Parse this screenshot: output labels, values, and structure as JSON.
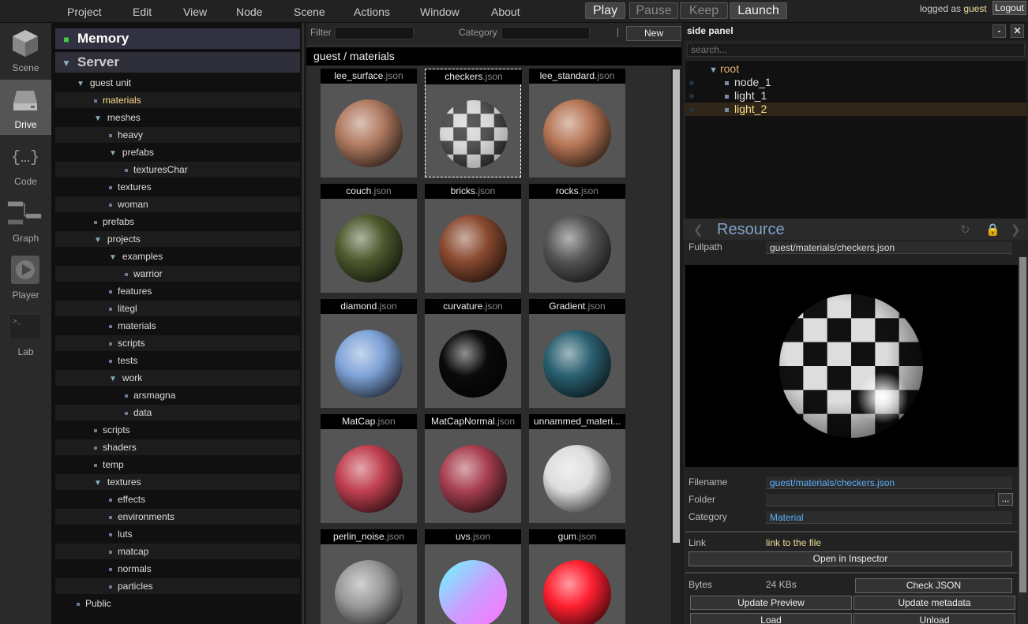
{
  "menubar": {
    "items": [
      "Project",
      "Edit",
      "View",
      "Node",
      "Scene",
      "Actions",
      "Window",
      "About"
    ],
    "controls": {
      "play": "Play",
      "pause": "Pause",
      "keep": "Keep",
      "launch": "Launch"
    },
    "login_prefix": "logged as",
    "login_user": "guest",
    "logout": "Logout"
  },
  "dock": {
    "items": [
      {
        "label": "Scene",
        "icon": "cube-icon"
      },
      {
        "label": "Drive",
        "icon": "drive-icon",
        "active": true
      },
      {
        "label": "Code",
        "icon": "code-braces-icon"
      },
      {
        "label": "Graph",
        "icon": "graph-icon"
      },
      {
        "label": "Player",
        "icon": "play-icon"
      },
      {
        "label": "Lab",
        "icon": "terminal-icon"
      }
    ]
  },
  "tree": {
    "memory_label": "Memory",
    "server_label": "Server",
    "rows": [
      {
        "label": "guest unit",
        "level": 1,
        "kind": "open",
        "selected": false
      },
      {
        "label": "materials",
        "level": 2,
        "kind": "leaf",
        "selected": true
      },
      {
        "label": "meshes",
        "level": 2,
        "kind": "open",
        "selected": false
      },
      {
        "label": "heavy",
        "level": 3,
        "kind": "leaf",
        "selected": false
      },
      {
        "label": "prefabs",
        "level": 3,
        "kind": "open",
        "selected": false
      },
      {
        "label": "texturesChar",
        "level": 4,
        "kind": "leaf",
        "selected": false
      },
      {
        "label": "textures",
        "level": 3,
        "kind": "leaf",
        "selected": false
      },
      {
        "label": "woman",
        "level": 3,
        "kind": "leaf",
        "selected": false
      },
      {
        "label": "prefabs",
        "level": 2,
        "kind": "leaf",
        "selected": false
      },
      {
        "label": "projects",
        "level": 2,
        "kind": "open",
        "selected": false
      },
      {
        "label": "examples",
        "level": 3,
        "kind": "open",
        "selected": false
      },
      {
        "label": "warrior",
        "level": 4,
        "kind": "leaf",
        "selected": false
      },
      {
        "label": "features",
        "level": 3,
        "kind": "leaf",
        "selected": false
      },
      {
        "label": "litegl",
        "level": 3,
        "kind": "leaf",
        "selected": false
      },
      {
        "label": "materials",
        "level": 3,
        "kind": "leaf",
        "selected": false
      },
      {
        "label": "scripts",
        "level": 3,
        "kind": "leaf",
        "selected": false
      },
      {
        "label": "tests",
        "level": 3,
        "kind": "leaf",
        "selected": false
      },
      {
        "label": "work",
        "level": 3,
        "kind": "open",
        "selected": false
      },
      {
        "label": "arsmagna",
        "level": 4,
        "kind": "leaf",
        "selected": false
      },
      {
        "label": "data",
        "level": 4,
        "kind": "leaf",
        "selected": false
      },
      {
        "label": "scripts",
        "level": 2,
        "kind": "leaf",
        "selected": false
      },
      {
        "label": "shaders",
        "level": 2,
        "kind": "leaf",
        "selected": false
      },
      {
        "label": "temp",
        "level": 2,
        "kind": "leaf",
        "selected": false
      },
      {
        "label": "textures",
        "level": 2,
        "kind": "open",
        "selected": false
      },
      {
        "label": "effects",
        "level": 3,
        "kind": "leaf",
        "selected": false
      },
      {
        "label": "environments",
        "level": 3,
        "kind": "leaf",
        "selected": false
      },
      {
        "label": "luts",
        "level": 3,
        "kind": "leaf",
        "selected": false
      },
      {
        "label": "matcap",
        "level": 3,
        "kind": "leaf",
        "selected": false
      },
      {
        "label": "normals",
        "level": 3,
        "kind": "leaf",
        "selected": false
      },
      {
        "label": "particles",
        "level": 3,
        "kind": "leaf",
        "selected": false
      },
      {
        "label": "Public",
        "level": 1,
        "kind": "leaf",
        "selected": false
      }
    ]
  },
  "files": {
    "filter_label": "Filter",
    "category_label": "Category",
    "new_button": "New",
    "path": "guest / materials",
    "cards": [
      {
        "name": "lee_surface",
        "ext": ".json",
        "color": "#b07a60",
        "style": "plain"
      },
      {
        "name": "checkers",
        "ext": ".json",
        "color": "#cccccc",
        "style": "checker",
        "selected": true
      },
      {
        "name": "lee_standard",
        "ext": ".json",
        "color": "#b57555",
        "style": "plain"
      },
      {
        "name": "couch",
        "ext": ".json",
        "color": "#4d5a2e",
        "style": "plain"
      },
      {
        "name": "bricks",
        "ext": ".json",
        "color": "#8a4a30",
        "style": "plain"
      },
      {
        "name": "rocks",
        "ext": ".json",
        "color": "#555555",
        "style": "plain"
      },
      {
        "name": "diamond",
        "ext": ".json",
        "color": "#7fa3d8",
        "style": "plain"
      },
      {
        "name": "curvature",
        "ext": ".json",
        "color": "#0a0a0a",
        "style": "plain"
      },
      {
        "name": "Gradient",
        "ext": ".json",
        "color": "#2a6070",
        "style": "plain"
      },
      {
        "name": "MatCap",
        "ext": ".json",
        "color": "#c04050",
        "style": "plain"
      },
      {
        "name": "MatCapNormal",
        "ext": ".json",
        "color": "#a84050",
        "style": "plain"
      },
      {
        "name": "unnammed_materi...",
        "ext": "",
        "color": "#dddddd",
        "style": "plain"
      },
      {
        "name": "perlin_noise",
        "ext": ".json",
        "color": "#999999",
        "style": "plain"
      },
      {
        "name": "uvs",
        "ext": ".json",
        "color": "#c080ff",
        "style": "uvs"
      },
      {
        "name": "gum",
        "ext": ".json",
        "color": "#ff2030",
        "style": "plain"
      }
    ]
  },
  "side": {
    "title": "side panel",
    "min_btn": "-",
    "close_btn": "✕",
    "search_placeholder": "search...",
    "scene": [
      {
        "label": "root",
        "level": 0,
        "selected": false
      },
      {
        "label": "node_1",
        "level": 1,
        "selected": false
      },
      {
        "label": "light_1",
        "level": 1,
        "selected": false
      },
      {
        "label": "light_2",
        "level": 1,
        "selected": true
      }
    ],
    "resource": {
      "title": "Resource",
      "fullpath_label": "Fullpath",
      "fullpath_value": "guest/materials/checkers.json",
      "filename_label": "Filename",
      "filename_value": "guest/materials/checkers.json",
      "folder_label": "Folder",
      "folder_value": "",
      "folder_btn": "...",
      "category_label": "Category",
      "category_value": "Material",
      "link_label": "Link",
      "link_value": "link to the file",
      "open_inspector": "Open in Inspector",
      "bytes_label": "Bytes",
      "bytes_value": "24 KBs",
      "check_json": "Check JSON",
      "update_preview": "Update Preview",
      "update_metadata": "Update metadata",
      "load": "Load",
      "unload": "Unload"
    }
  }
}
